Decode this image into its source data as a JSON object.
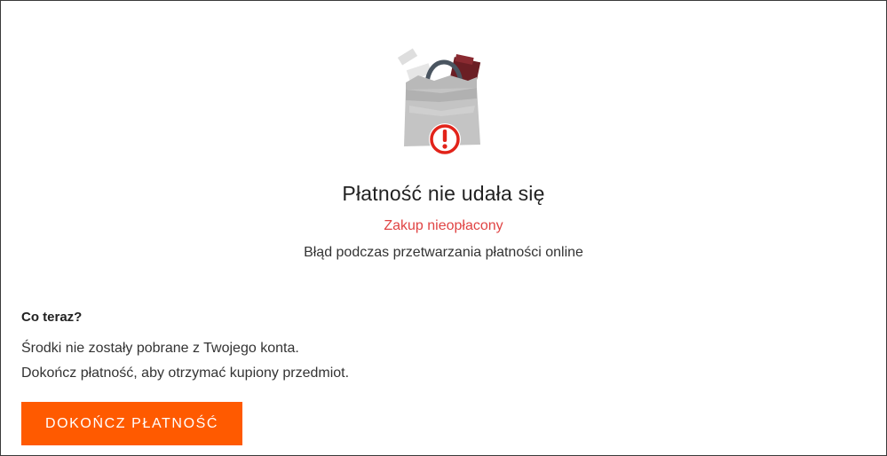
{
  "status_page": {
    "title": "Płatność nie udała się",
    "status_label": "Zakup nieopłacony",
    "detail": "Błąd podczas przetwarzania płatności online",
    "illustration_icon": "shopping-bag-error-icon"
  },
  "next_steps": {
    "heading": "Co teraz?",
    "lines": [
      "Środki nie zostały pobrane z Twojego konta.",
      "Dokończ płatność, aby otrzymać kupiony przedmiot."
    ],
    "button_label": "DOKOŃCZ PŁATNOŚĆ"
  },
  "colors": {
    "accent": "#ff5a00",
    "error": "#e04444",
    "text": "#222222",
    "bag_gray": "#c2c2c2",
    "bag_handle": "#4a5560",
    "item_dark": "#6b1e24"
  }
}
